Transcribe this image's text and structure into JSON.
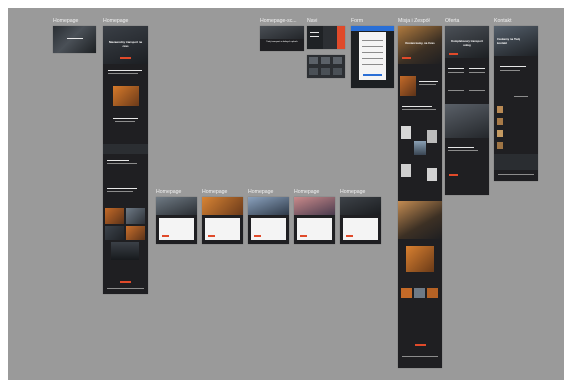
{
  "canvas": {
    "background": "#9a9a9a"
  },
  "frames": {
    "f1": {
      "label": "Homepage"
    },
    "f2": {
      "label": "Homepage",
      "hero_title": "Niezawodny transport na czas"
    },
    "f3": {
      "label": "Homepage-sc...",
      "caption": "Twój transport w dobrych rękach"
    },
    "f4": {
      "label": "Navi"
    },
    "f5": {
      "label": "Form"
    },
    "f6": {
      "label": "Misja i Zespół",
      "hero_title": "Dostarczamy, na Czas"
    },
    "f7": {
      "label": "Oferta",
      "hero_title": "Kompleksowy transport usług"
    },
    "f8": {
      "label": "Kontakt",
      "hero_title": "Czekamy na Twój kontakt"
    },
    "row2": [
      {
        "label": "Homepage"
      },
      {
        "label": "Homepage"
      },
      {
        "label": "Homepage"
      },
      {
        "label": "Homepage"
      },
      {
        "label": "Homepage"
      }
    ]
  },
  "colors": {
    "frame_bg": "#1f1f22",
    "accent": "#e04a2a",
    "form_blue": "#2a6fd6"
  }
}
